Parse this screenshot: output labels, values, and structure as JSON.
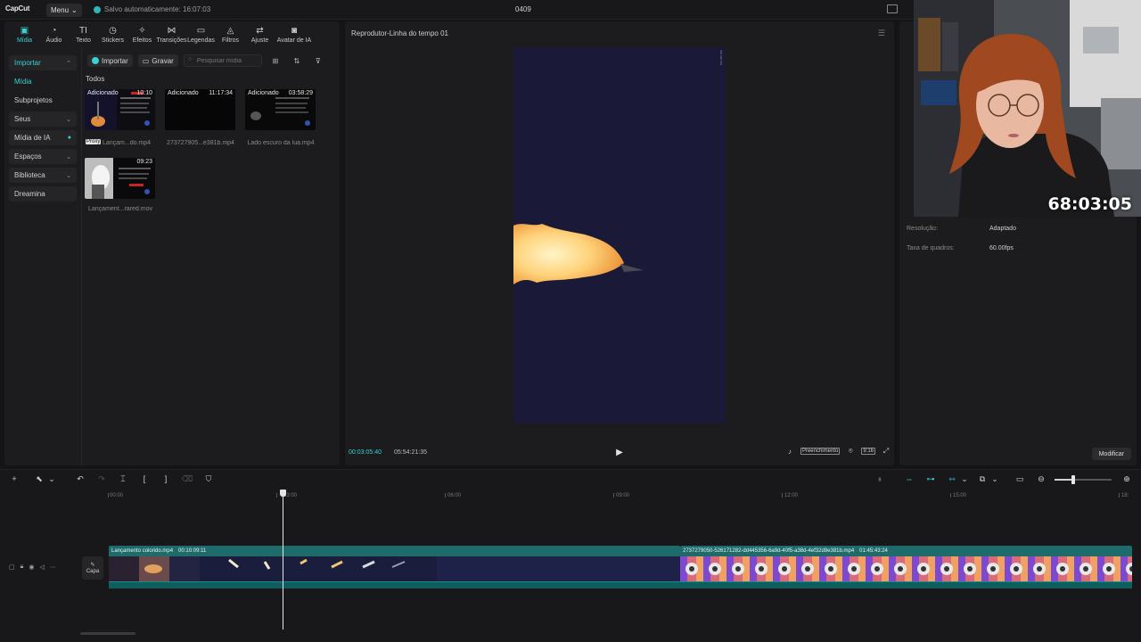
{
  "app": {
    "logo": "CapCut",
    "menu_label": "Menu",
    "autosave": "Salvo automaticamente: 16:07:03",
    "project_title": "0409"
  },
  "toolbar": {
    "items": [
      {
        "label": "Mídia",
        "icon": "media-icon"
      },
      {
        "label": "Áudio",
        "icon": "audio-icon"
      },
      {
        "label": "Texto",
        "icon": "text-icon"
      },
      {
        "label": "Stickers",
        "icon": "sticker-icon"
      },
      {
        "label": "Efeitos",
        "icon": "effects-icon"
      },
      {
        "label": "Transições",
        "icon": "transitions-icon"
      },
      {
        "label": "Legendas",
        "icon": "captions-icon"
      },
      {
        "label": "Filtros",
        "icon": "filters-icon"
      },
      {
        "label": "Ajuste",
        "icon": "adjust-icon"
      },
      {
        "label": "Avatar de IA",
        "icon": "ai-avatar-icon"
      }
    ]
  },
  "sidebar": {
    "items": [
      {
        "label": "Importar"
      },
      {
        "label": "Mídia"
      },
      {
        "label": "Subprojetos"
      },
      {
        "label": "Seus"
      },
      {
        "label": "Mídia de IA"
      },
      {
        "label": "Espaços"
      },
      {
        "label": "Biblioteca"
      },
      {
        "label": "Dreamina"
      }
    ]
  },
  "media": {
    "import_label": "Importar",
    "record_label": "Gravar",
    "search_placeholder": "Pesquisar mídia",
    "all_label": "Todos",
    "proxy_label": "Proxy",
    "items": [
      {
        "tag": "Adicionado",
        "duration": "10:10",
        "name": "Lançam...do.mp4"
      },
      {
        "tag": "Adicionado",
        "duration": "11:17:34",
        "name": "2737279​05...e381b.mp4"
      },
      {
        "tag": "Adicionado",
        "duration": "03:58:29",
        "name": "Lado escuro da lua.mp4"
      },
      {
        "tag": "",
        "duration": "09:23",
        "name": "Lançament...rared.mov"
      }
    ]
  },
  "player": {
    "title": "Reprodutor-Linha do tempo 01",
    "current_time": "00:03:05:40",
    "total_time": "05:54:21:35",
    "fill_label": "Preenchimento",
    "ratio_label": "9:16"
  },
  "properties": {
    "resolution_label": "Resolução:",
    "resolution_value": "Adaptado",
    "framerate_label": "Taxa de quadros:",
    "framerate_value": "60.00fps",
    "modify_label": "Modificar"
  },
  "webcam": {
    "timer": "68:03:05"
  },
  "timeline": {
    "ruler": [
      "00:00",
      "03:00",
      "06:00",
      "09:00",
      "12:00",
      "15:00",
      "18:"
    ],
    "cover_label": "Capa",
    "zoom_level": 0.33,
    "clips": [
      {
        "name": "Lançamento colorido.mp4",
        "duration": "00:10:09:11"
      },
      {
        "name": "2737279050-526171282-dd445356-6a9d-40f5-a38d-4ef32d9e381b.mp4",
        "duration": "01:45:43:24"
      }
    ]
  },
  "colors": {
    "accent": "#3ad1d1",
    "clip_header": "#1f6a6a",
    "video_bg": "#1a1a38"
  }
}
